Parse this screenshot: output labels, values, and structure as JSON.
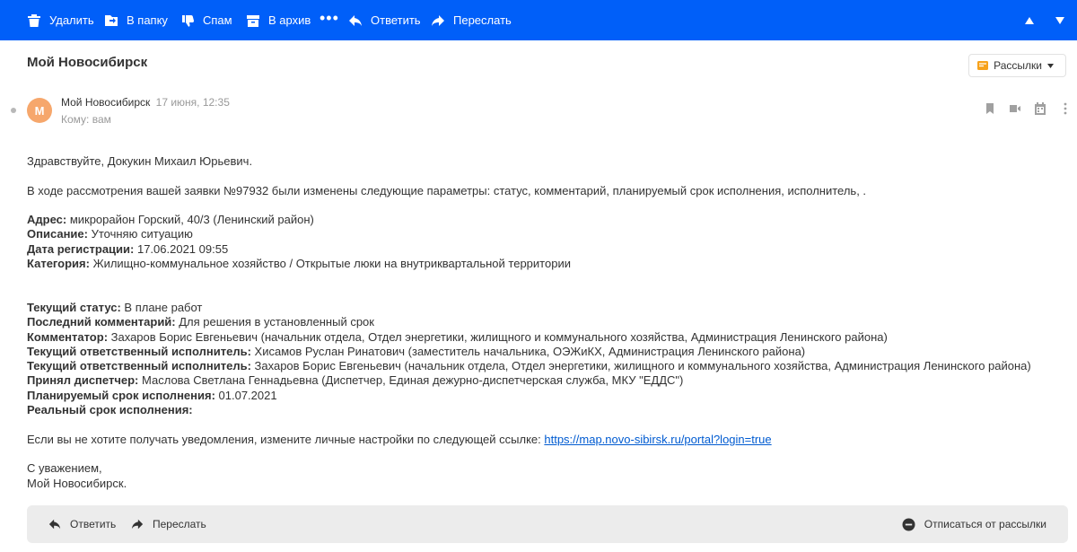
{
  "toolbar": {
    "delete_label": "Удалить",
    "folder_label": "В папку",
    "spam_label": "Спам",
    "archive_label": "В архив",
    "more_label": "•••",
    "reply_label": "Ответить",
    "forward_label": "Переслать"
  },
  "message": {
    "subject": "Мой Новосибирск",
    "newsletter_label": "Рассылки",
    "avatar_letter": "М",
    "sender_name": "Мой Новосибирск",
    "date": "17 июня, 12:35",
    "to": "Кому: вам"
  },
  "body": {
    "greeting": "Здравствуйте, Докукин Михаил Юрьевич.",
    "intro": "В ходе рассмотрения вашей заявки №97932 были изменены следующие параметры: статус, комментарий, планируемый срок исполнения, исполнитель, .",
    "fields1": [
      {
        "label": "Адрес:",
        "value": " микрорайон Горский, 40/3 (Ленинский район)"
      },
      {
        "label": "Описание:",
        "value": " Уточняю ситуацию"
      },
      {
        "label": "Дата регистрации:",
        "value": " 17.06.2021 09:55"
      },
      {
        "label": "Категория:",
        "value": " Жилищно-коммунальное хозяйство / Открытые люки на внутриквартальной территории"
      }
    ],
    "fields2": [
      {
        "label": "Текущий статус:",
        "value": " В плане работ"
      },
      {
        "label": "Последний комментарий:",
        "value": " Для решения в установленный срок"
      },
      {
        "label": "Комментатор:",
        "value": " Захаров Борис Евгеньевич (начальник отдела, Отдел энергетики, жилищного и коммунального хозяйства, Администрация Ленинского района)"
      },
      {
        "label": "Текущий ответственный исполнитель:",
        "value": " Хисамов Руслан Ринатович (заместитель начальника, ОЭЖиКХ, Администрация Ленинского района)"
      },
      {
        "label": "Текущий ответственный исполнитель:",
        "value": " Захаров Борис Евгеньевич (начальник отдела, Отдел энергетики, жилищного и коммунального хозяйства, Администрация Ленинского района)"
      },
      {
        "label": "Принял диспетчер:",
        "value": " Маслова Светлана Геннадьевна (Диспетчер, Единая дежурно-диспетчерская служба, МКУ \"ЕДДС\")"
      },
      {
        "label": "Планируемый срок исполнения:",
        "value": " 01.07.2021"
      },
      {
        "label": "Реальный срок исполнения:",
        "value": ""
      }
    ],
    "unsubscribe_text": "Если вы не хотите получать уведомления, измените личные настройки по следующей ссылке: ",
    "unsubscribe_link": "https://map.novo-sibirsk.ru/portal?login=true",
    "regards": "С уважением,",
    "signature": "Мой Новосибирск."
  },
  "footer": {
    "reply_label": "Ответить",
    "forward_label": "Переслать",
    "unsubscribe_label": "Отписаться от рассылки"
  },
  "colors": {
    "toolbar_bg": "#005ff9",
    "avatar_bg": "#f6a76c",
    "link": "#005bd1"
  }
}
